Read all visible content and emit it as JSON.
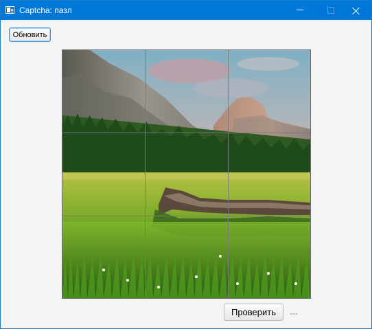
{
  "window": {
    "title": "Captcha: пазл",
    "icon": "app-window-icon",
    "controls": [
      "minimize-icon",
      "maximize-icon",
      "close-icon"
    ]
  },
  "toolbar": {
    "refresh_label": "Обновить"
  },
  "puzzle": {
    "rows": 3,
    "cols": 3,
    "image_subject": "mountain valley with meadow and fallen log"
  },
  "footer": {
    "check_label": "Проверить",
    "status_text": "---"
  },
  "colors": {
    "titlebar": "#0078d7",
    "background": "#f4f4f4",
    "focus_border": "#3d95d6"
  }
}
